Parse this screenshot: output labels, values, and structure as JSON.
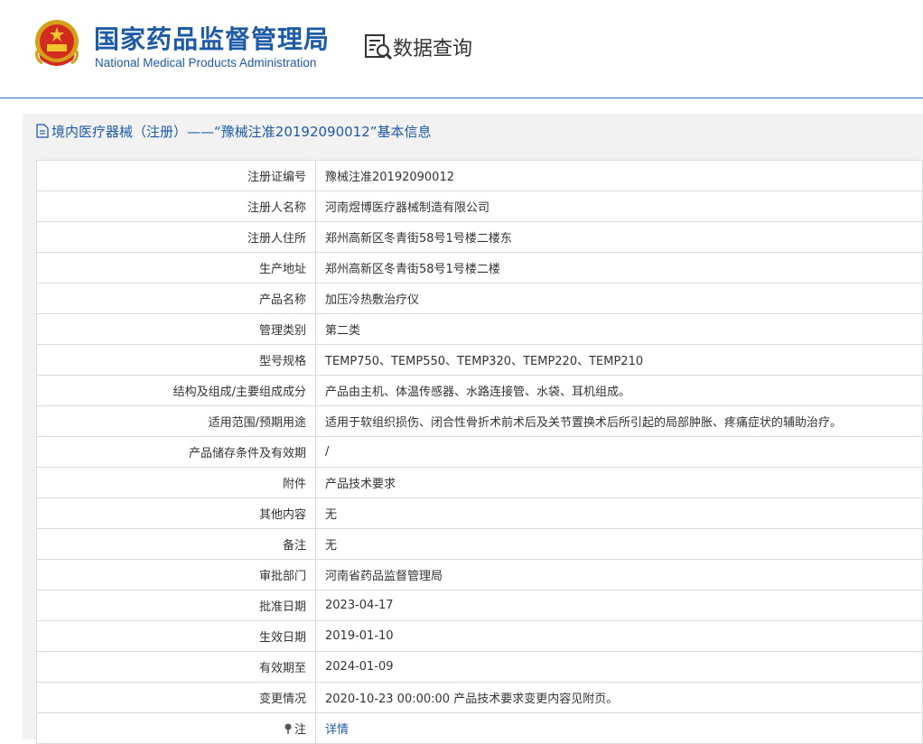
{
  "header": {
    "org_cn": "国家药品监督管理局",
    "org_en": "National Medical Products Administration",
    "nav_label": "数据查询",
    "brand_color": "#1d5aa8"
  },
  "title": {
    "text": "境内医疗器械（注册）——“豫械注准20192090012”基本信息"
  },
  "rows": [
    {
      "label": "注册证编号",
      "value": "豫械注准20192090012"
    },
    {
      "label": "注册人名称",
      "value": "河南煜博医疗器械制造有限公司"
    },
    {
      "label": "注册人住所",
      "value": "郑州高新区冬青街58号1号楼二楼东"
    },
    {
      "label": "生产地址",
      "value": "郑州高新区冬青街58号1号楼二楼"
    },
    {
      "label": "产品名称",
      "value": "加压冷热敷治疗仪"
    },
    {
      "label": "管理类别",
      "value": "第二类"
    },
    {
      "label": "型号规格",
      "value": "TEMP750、TEMP550、TEMP320、TEMP220、TEMP210"
    },
    {
      "label": "结构及组成/主要组成成分",
      "value": "产品由主机、体温传感器、水路连接管、水袋、耳机组成。"
    },
    {
      "label": "适用范围/预期用途",
      "value": "适用于软组织损伤、闭合性骨折术前术后及关节置换术后所引起的局部肿胀、疼痛症状的辅助治疗。"
    },
    {
      "label": "产品储存条件及有效期",
      "value": "/"
    },
    {
      "label": "附件",
      "value": "产品技术要求"
    },
    {
      "label": "其他内容",
      "value": "无"
    },
    {
      "label": "备注",
      "value": "无"
    },
    {
      "label": "审批部门",
      "value": "河南省药品监督管理局"
    },
    {
      "label": "批准日期",
      "value": "2023-04-17"
    },
    {
      "label": "生效日期",
      "value": "2019-01-10"
    },
    {
      "label": "有效期至",
      "value": "2024-01-09"
    },
    {
      "label": "变更情况",
      "value": "2020-10-23 00:00:00 产品技术要求变更内容见附页。"
    }
  ],
  "note_row": {
    "label": "注",
    "link": "详情",
    "icon": "pin-icon"
  }
}
